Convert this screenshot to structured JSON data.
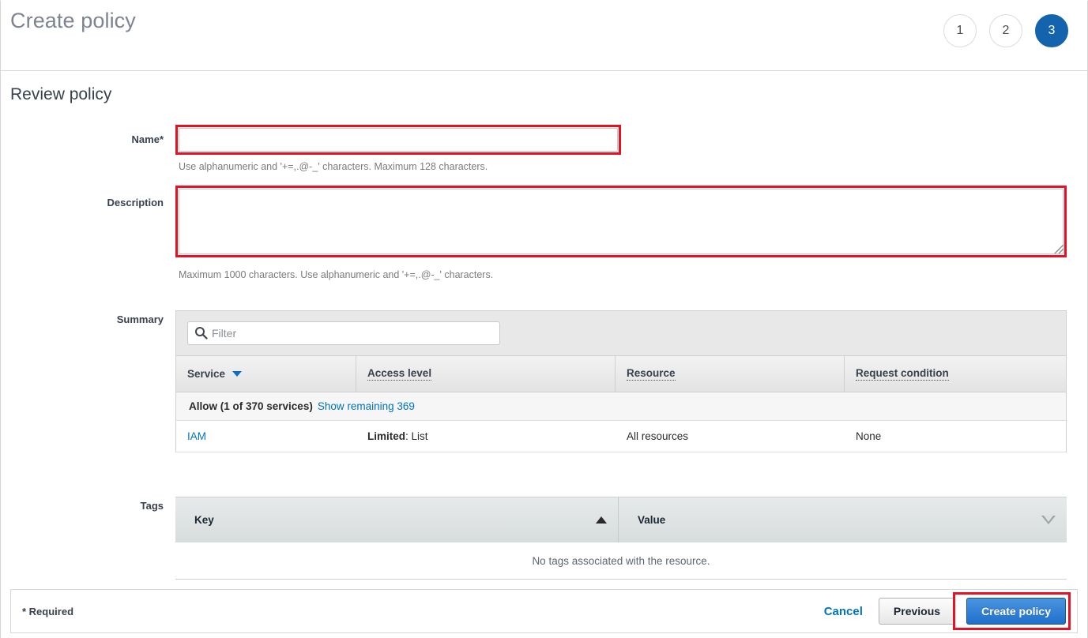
{
  "header": {
    "title": "Create policy",
    "steps": [
      {
        "label": "1",
        "active": false
      },
      {
        "label": "2",
        "active": false
      },
      {
        "label": "3",
        "active": true
      }
    ]
  },
  "main": {
    "section_title": "Review policy",
    "name": {
      "label": "Name*",
      "value": "",
      "placeholder": "",
      "hint": "Use alphanumeric and '+=,.@-_' characters. Maximum 128 characters."
    },
    "description": {
      "label": "Description",
      "value": "",
      "placeholder": "",
      "hint": "Maximum 1000 characters. Use alphanumeric and '+=,.@-_' characters."
    },
    "summary": {
      "label": "Summary",
      "filter_placeholder": "Filter",
      "filter_value": "",
      "columns": [
        "Service",
        "Access level",
        "Resource",
        "Request condition"
      ],
      "group_row": {
        "label": "Allow (1 of 370 services)",
        "link": "Show remaining 369"
      },
      "rows": [
        {
          "service": "IAM",
          "access_level_prefix": "Limited",
          "access_level_value": ": List",
          "resource": "All resources",
          "request_condition": "None"
        }
      ]
    },
    "tags": {
      "label": "Tags",
      "columns": [
        "Key",
        "Value"
      ],
      "empty_message": "No tags associated with the resource."
    }
  },
  "footer": {
    "required_note": "* Required",
    "cancel": "Cancel",
    "previous": "Previous",
    "create": "Create policy"
  },
  "colors": {
    "accent_blue": "#0073bb",
    "step_active": "#1464ad",
    "annotation_red": "#e81123",
    "primary_button": "#1f6fcc"
  }
}
